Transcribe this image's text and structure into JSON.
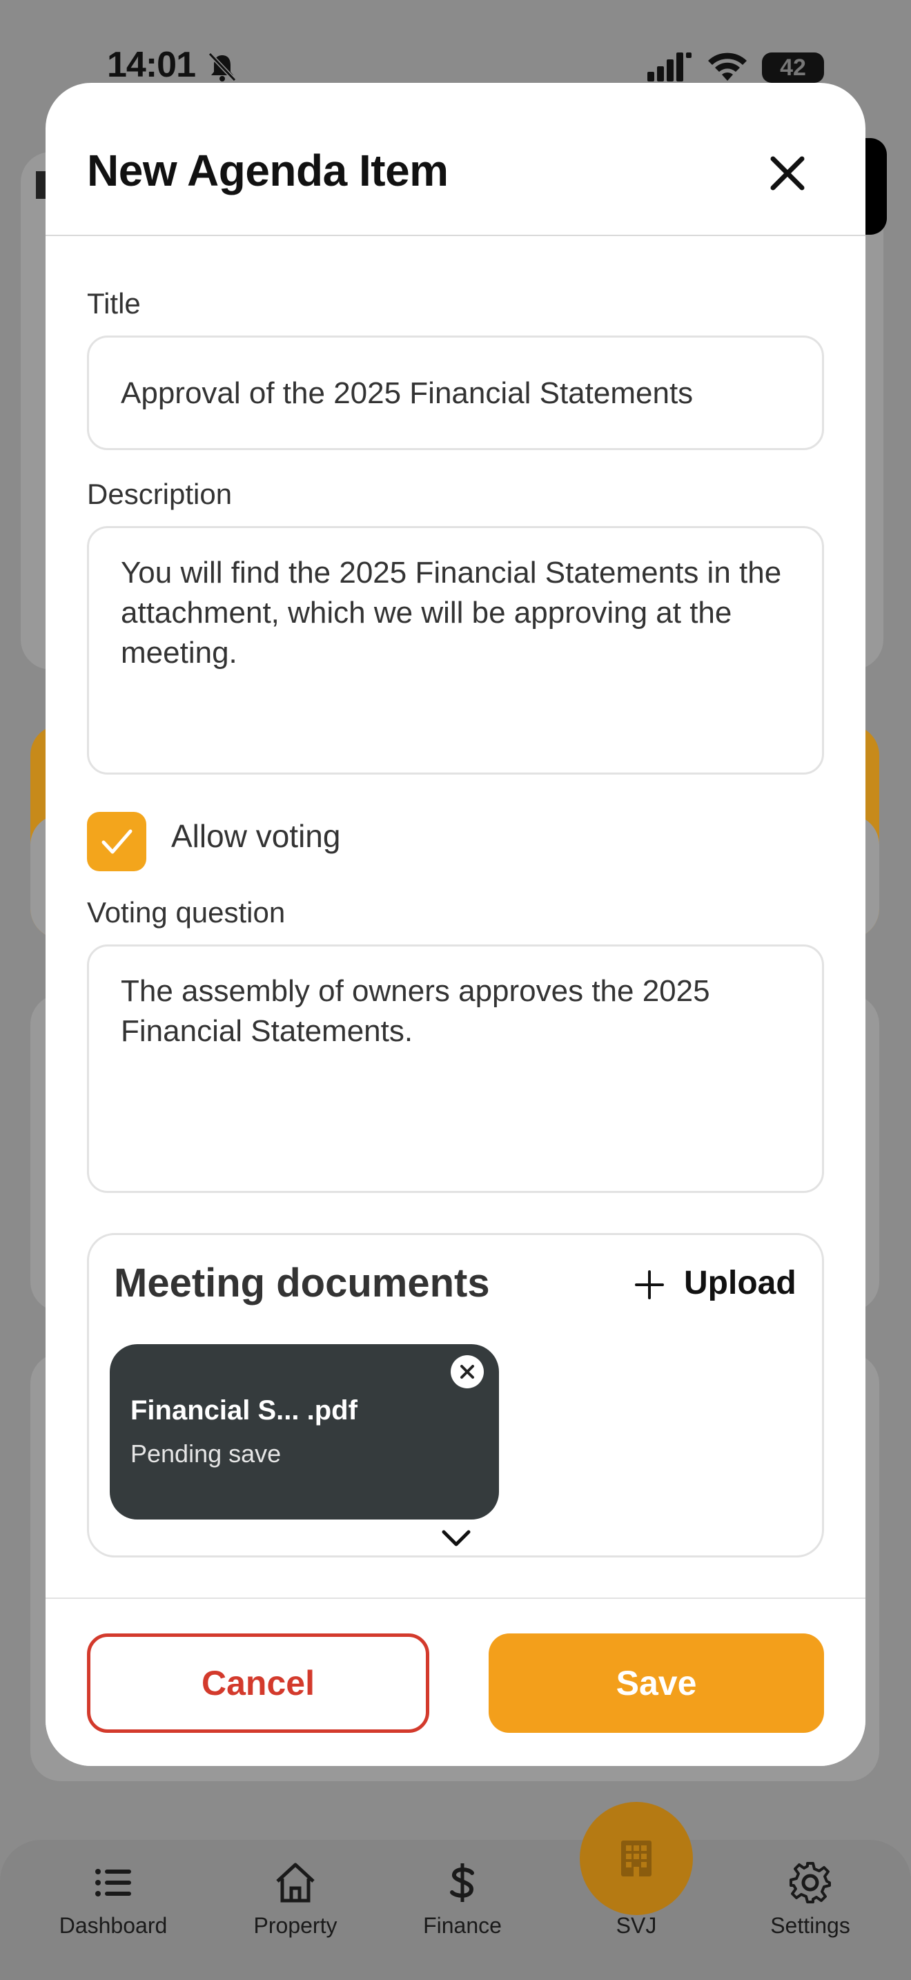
{
  "status_bar": {
    "time": "14:01",
    "battery": "42"
  },
  "modal": {
    "title": "New Agenda Item",
    "fields": {
      "title_label": "Title",
      "title_value": "Approval of the 2025 Financial Statements",
      "description_label": "Description",
      "description_value": "You will find the 2025 Financial Statements in the attachment, which we will be approving at the meeting.",
      "allow_voting_label": "Allow voting",
      "allow_voting_checked": true,
      "voting_question_label": "Voting question",
      "voting_question_value": "The assembly of owners approves the 2025 Financial Statements."
    },
    "documents": {
      "title": "Meeting documents",
      "upload_label": "Upload",
      "files": [
        {
          "name": "Financial S... .pdf",
          "status": "Pending save"
        }
      ]
    },
    "footer": {
      "cancel_label": "Cancel",
      "save_label": "Save"
    }
  },
  "tab_bar": {
    "items": [
      {
        "label": "Dashboard",
        "icon": "list-icon"
      },
      {
        "label": "Property",
        "icon": "house-icon"
      },
      {
        "label": "Finance",
        "icon": "dollar-icon"
      },
      {
        "label": "SVJ",
        "icon": "building-icon"
      },
      {
        "label": "Settings",
        "icon": "gear-icon"
      }
    ]
  },
  "colors": {
    "accent": "#f39f1b",
    "danger": "#d33a2c",
    "doc_card": "#353b3d"
  }
}
